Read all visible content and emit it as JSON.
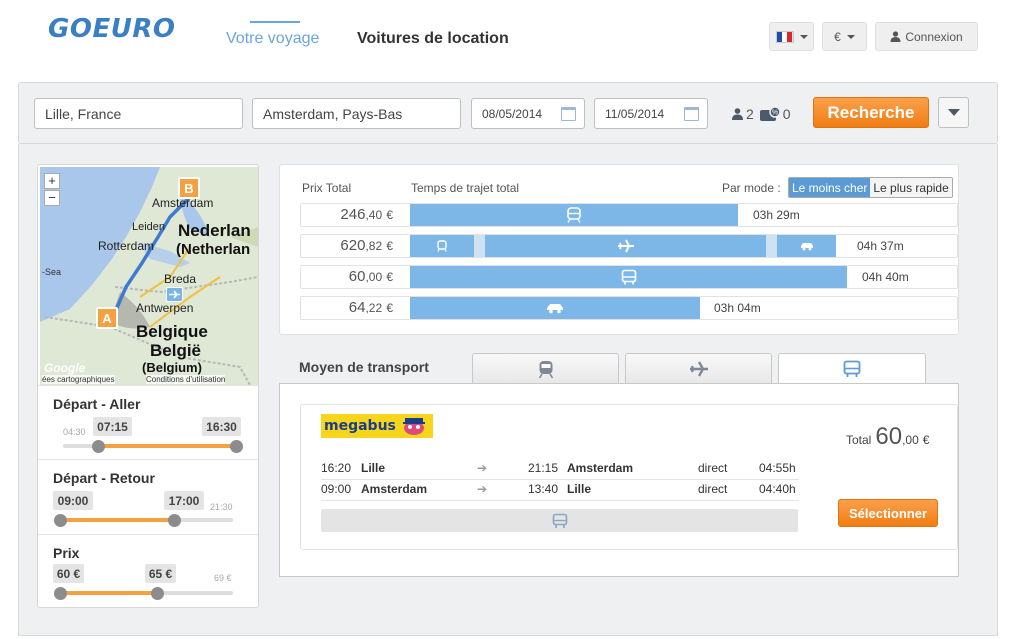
{
  "header": {
    "logo": "GOEURO",
    "nav": [
      {
        "label": "Votre voyage",
        "active": true
      },
      {
        "label": "Voitures de location",
        "active": false
      }
    ],
    "currency": "€",
    "login": "Connexion",
    "flag_colors": [
      "#1f4ea8",
      "#ffffff",
      "#e0262c"
    ]
  },
  "search": {
    "from": "Lille, France",
    "to": "Amsterdam, Pays-Bas",
    "depart_date": "08/05/2014",
    "return_date": "11/05/2014",
    "adults": "2",
    "discount_cards": "0",
    "submit": "Recherche"
  },
  "map": {
    "labels": {
      "b_city": "Amsterdam",
      "nederland": "Nederlan",
      "netherlands": "(Netherlan",
      "leiden": "Leiden",
      "rotterdam": "Rotterdam",
      "sea": "-Sea",
      "breda": "Breda",
      "antwerpen": "Antwerpen",
      "belgique": "Belgique",
      "belgie": "België",
      "belgium": "(Belgium)"
    },
    "marker_a": "A",
    "marker_b": "B",
    "zoom_in": "+",
    "zoom_out": "−",
    "credits_left": "ées cartographiques",
    "credits_right": "Conditions d'utilisation",
    "google": "Google"
  },
  "filters": {
    "aller": {
      "title": "Départ - Aller",
      "min_label": "04:30",
      "from": "07:15",
      "to": "16:30"
    },
    "retour": {
      "title": "Départ - Retour",
      "from": "09:00",
      "to": "17:00",
      "max_label": "21:30"
    },
    "prix": {
      "title": "Prix",
      "from": "60 €",
      "to": "65 €",
      "max_label": "69 €"
    }
  },
  "results": {
    "head_price": "Prix Total",
    "head_time": "Temps de trajet total",
    "sort_label": "Par mode :",
    "sort_cheapest": "Le moins cher",
    "sort_fastest": "Le plus rapide",
    "rows": [
      {
        "price_int": "246",
        "price_dec": ",40",
        "currency": "€",
        "duration": "03h 29m",
        "mode": "train"
      },
      {
        "price_int": "620",
        "price_dec": ",82",
        "currency": "€",
        "duration": "04h 37m",
        "mode": "flight"
      },
      {
        "price_int": "60",
        "price_dec": ",00",
        "currency": "€",
        "duration": "04h 40m",
        "mode": "bus"
      },
      {
        "price_int": "64",
        "price_dec": ",22",
        "currency": "€",
        "duration": "03h 04m",
        "mode": "car"
      }
    ]
  },
  "tabs": {
    "label": "Moyen de transport",
    "items": [
      "train",
      "flight",
      "bus"
    ]
  },
  "bus_result": {
    "operator": "megabus",
    "legs": [
      {
        "dep_time": "16:20",
        "dep_city": "Lille",
        "arr_time": "21:15",
        "arr_city": "Amsterdam",
        "type": "direct",
        "duration": "04:55h"
      },
      {
        "dep_time": "09:00",
        "dep_city": "Amsterdam",
        "arr_time": "13:40",
        "arr_city": "Lille",
        "type": "direct",
        "duration": "04:40h"
      }
    ],
    "total_label": "Total",
    "total_int": "60",
    "total_dec": ",00",
    "total_currency": "€",
    "select": "Sélectionner"
  }
}
